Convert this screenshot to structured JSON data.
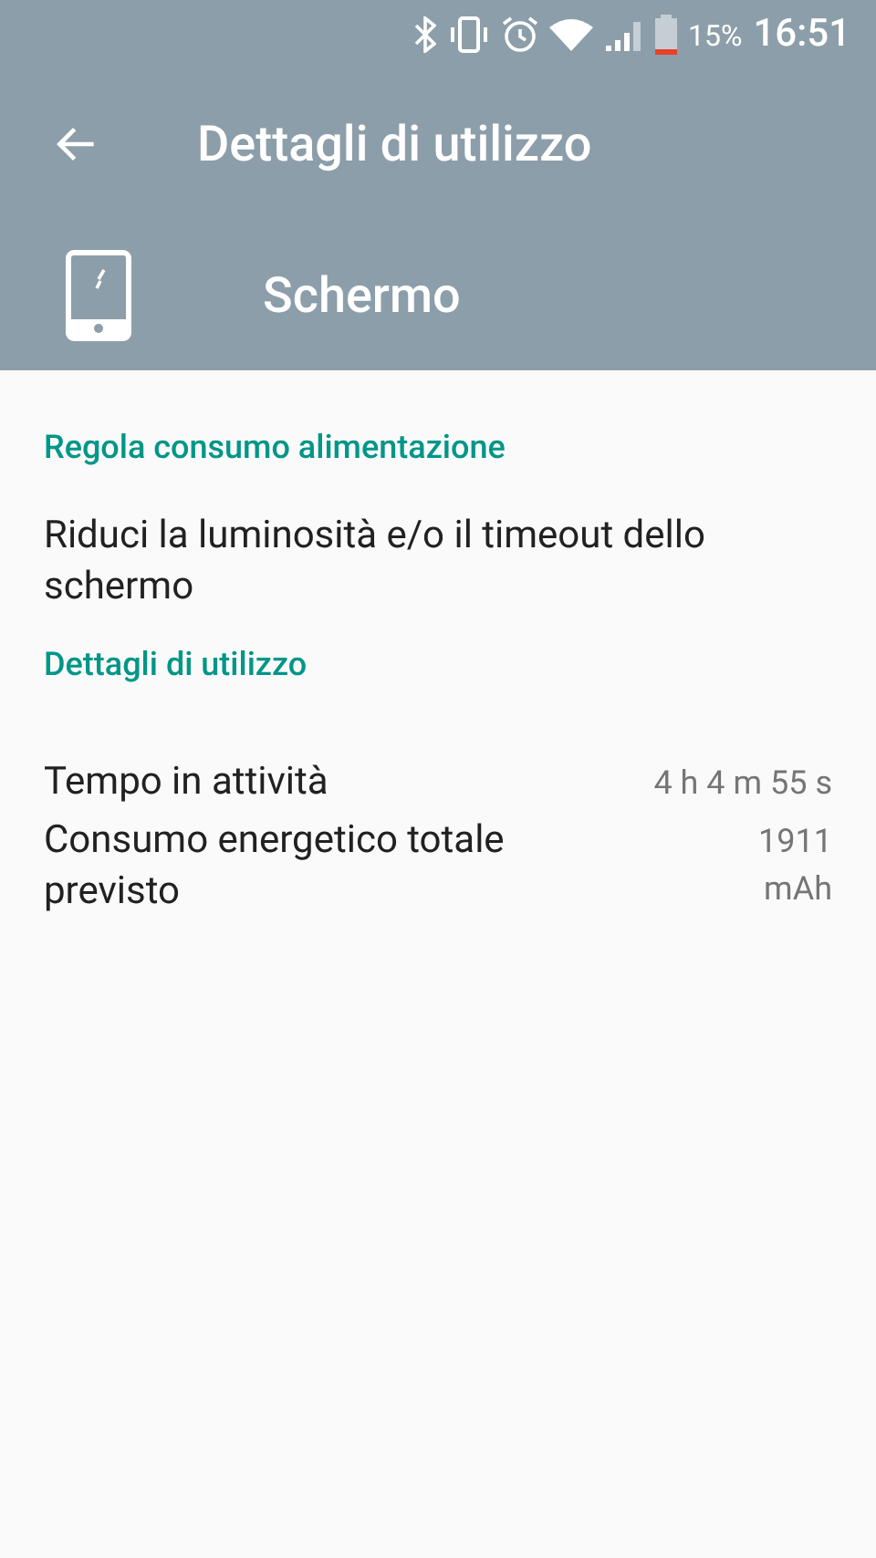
{
  "status_bar": {
    "battery_percent": "15%",
    "time": "16:51"
  },
  "toolbar": {
    "title": "Dettagli di utilizzo"
  },
  "app_header": {
    "title": "Schermo"
  },
  "sections": [
    {
      "title": "Regola consumo alimentazione",
      "items": [
        {
          "kind": "text",
          "text": "Riduci la luminosità e/o il timeout dello schermo"
        }
      ]
    },
    {
      "title": "Dettagli di utilizzo",
      "items": [
        {
          "kind": "pair",
          "label": "Tempo in attività",
          "value": "4 h 4 m 55 s"
        },
        {
          "kind": "pair",
          "label": "Consumo energetico totale previsto",
          "value": "1911 mAh"
        }
      ]
    }
  ]
}
